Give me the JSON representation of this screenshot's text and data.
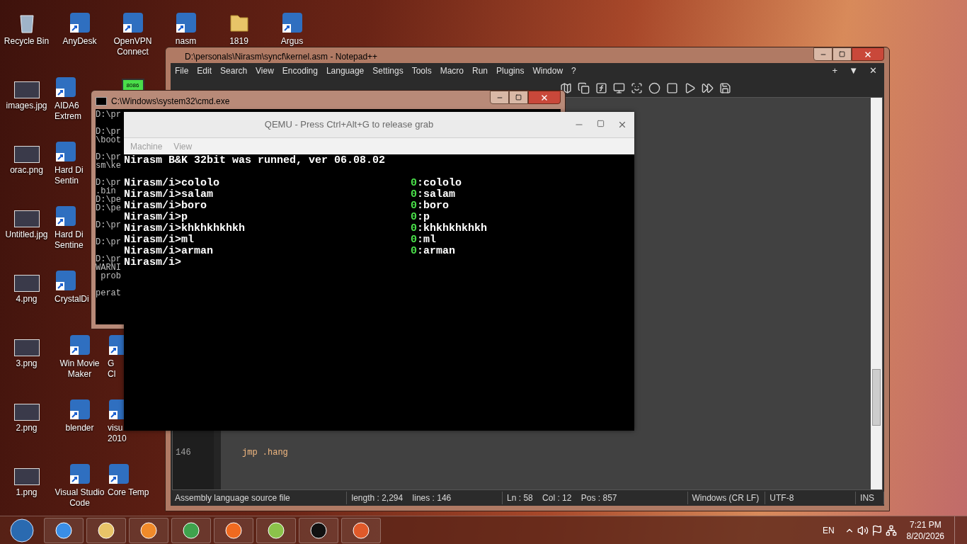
{
  "desktop": {
    "columns": [
      {
        "top": [
          {
            "label": "Recycle Bin",
            "kind": "bin"
          },
          {
            "label": "images.jpg",
            "kind": "image"
          },
          {
            "label": "orac.png",
            "kind": "image"
          },
          {
            "label": "Untitled.jpg",
            "kind": "image"
          },
          {
            "label": "4.png",
            "kind": "image"
          },
          {
            "label": "3.png",
            "kind": "image"
          },
          {
            "label": "2.png",
            "kind": "image"
          },
          {
            "label": "1.png",
            "kind": "image"
          }
        ]
      },
      {
        "top": [
          {
            "label": "AnyDesk",
            "kind": "shortcut"
          },
          {
            "label": "AIDA6\nExtrem",
            "kind": "shortcut"
          },
          {
            "label": "Hard Di\nSentin",
            "kind": "shortcut"
          },
          {
            "label": "Hard Di\nSentine",
            "kind": "shortcut"
          },
          {
            "label": "CrystalDi",
            "kind": "shortcut"
          },
          {
            "label": "Win Movie\nMaker",
            "kind": "shortcut"
          },
          {
            "label": "blender",
            "kind": "shortcut"
          },
          {
            "label": "Visual Studio\nCode",
            "kind": "shortcut"
          }
        ]
      },
      {
        "top": [
          {
            "label": "OpenVPN\nConnect",
            "kind": "shortcut"
          },
          {
            "label": "8086",
            "kind": "chip"
          }
        ],
        "bottom": [
          {
            "label": "G\nCl",
            "kind": "shortcut"
          },
          {
            "label": "visu\n2010",
            "kind": "shortcut"
          },
          {
            "label": "Core Temp",
            "kind": "shortcut"
          }
        ]
      },
      {
        "top": [
          {
            "label": "nasm",
            "kind": "shortcut"
          }
        ]
      },
      {
        "top": [
          {
            "label": "1819",
            "kind": "folder"
          }
        ]
      },
      {
        "top": [
          {
            "label": "Argus",
            "kind": "shortcut"
          }
        ]
      }
    ]
  },
  "notepad": {
    "title": "D:\\personals\\Nirasm\\syncf\\kernel.asm - Notepad++",
    "menu": [
      "File",
      "Edit",
      "Search",
      "View",
      "Encoding",
      "Language",
      "Settings",
      "Tools",
      "Macro",
      "Run",
      "Plugins",
      "Window",
      "?"
    ],
    "menu_right": [
      "+",
      "▼",
      "✕"
    ],
    "code_lines": [
      {
        "number": "146",
        "text": "jmp .hang"
      }
    ],
    "status_bar": [
      "Assembly language source file",
      "length : 2,294    lines : 146",
      "Ln : 58    Col : 12    Pos : 857",
      "Windows (CR LF)",
      "UTF-8",
      "INS"
    ]
  },
  "cmd": {
    "title": "C:\\Windows\\system32\\cmd.exe",
    "blocks": [
      [
        "D:\\pr"
      ],
      [
        "D:\\pr",
        "\\boot"
      ],
      [
        "D:\\pr",
        "sm\\ke"
      ],
      [
        "D:\\pr",
        ".bin",
        "D:\\pe",
        "D:\\pe"
      ],
      [
        "D:\\pr"
      ],
      [
        "D:\\pr"
      ],
      [
        "D:\\pr",
        "WARNI",
        " prob"
      ],
      [
        "perat"
      ]
    ]
  },
  "qemu": {
    "title": "QEMU - Press Ctrl+Alt+G to release grab",
    "menu": [
      "Machine",
      "View"
    ],
    "header": "Nirasm B&K 32bit was runned, ver 06.08.02",
    "rows": [
      {
        "input": "Nirasm/i>cololo",
        "code": "0",
        "output": ":cololo"
      },
      {
        "input": "Nirasm/i>salam",
        "code": "0",
        "output": ":salam"
      },
      {
        "input": "Nirasm/i>boro",
        "code": "0",
        "output": ":boro"
      },
      {
        "input": "Nirasm/i>p",
        "code": "0",
        "output": ":p"
      },
      {
        "input": "Nirasm/i>khkhkhkhkh",
        "code": "0",
        "output": ":khkhkhkhkh"
      },
      {
        "input": "Nirasm/i>ml",
        "code": "0",
        "output": ":ml"
      },
      {
        "input": "Nirasm/i>arman",
        "code": "0",
        "output": ":arman"
      }
    ],
    "prompt": "Nirasm/i>"
  },
  "taskbar": {
    "apps": [
      {
        "kind": "ie"
      },
      {
        "kind": "explorer"
      },
      {
        "kind": "media"
      },
      {
        "kind": "chrome"
      },
      {
        "kind": "firefox"
      },
      {
        "kind": "notepad"
      },
      {
        "kind": "cmd"
      },
      {
        "kind": "qemu"
      }
    ],
    "language": "EN",
    "time": "7:21 PM",
    "date": "8/20/2026"
  }
}
